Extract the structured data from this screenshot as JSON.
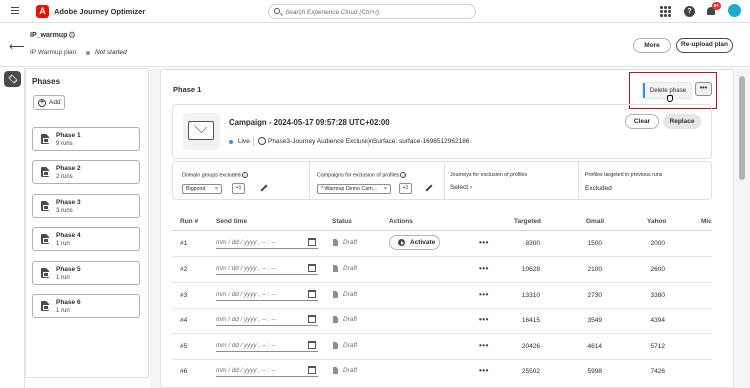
{
  "topbar": {
    "logo_letter": "A",
    "app_title": "Adobe Journey Optimizer",
    "search_placeholder": "Search Experience Cloud (Ctrl+/)",
    "notification_count": "9+"
  },
  "header": {
    "plan_name": "IP_warmup",
    "plan_type": "IP Warmup plan",
    "status": "Not started",
    "more_label": "More",
    "reupload_label": "Re-upload plan"
  },
  "phases_panel": {
    "title": "Phases",
    "add_label": "Add",
    "items": [
      {
        "name": "Phase 1",
        "runs": "9 runs"
      },
      {
        "name": "Phase 2",
        "runs": "2 runs"
      },
      {
        "name": "Phase 3",
        "runs": "3 runs"
      },
      {
        "name": "Phase 4",
        "runs": "1 run"
      },
      {
        "name": "Phase 5",
        "runs": "1 run"
      },
      {
        "name": "Phase 6",
        "runs": "1 run"
      }
    ]
  },
  "phase": {
    "title": "Phase 1",
    "delete_label": "Delete phase",
    "more_glyph": "•••",
    "campaign": {
      "name": "Campaign - 2024-05-17 09:57:28 UTC+02:00",
      "state": "Live",
      "journey": "Phase3-Journey Audience Exclusion",
      "surface": "Surface: surface-1696512962186",
      "clear_label": "Clear",
      "replace_label": "Replace"
    },
    "exclusions": {
      "domain_label": "Domain groups excluded",
      "domain_tag": "Bigpond",
      "domain_more": "+1",
      "campaigns_label": "Campaigns for exclusion of profiles",
      "campaigns_tag": "* Warmup Demo Cam...",
      "campaigns_more": "+1",
      "journeys_label": "Journeys for exclusion of profiles",
      "journeys_select": "Select",
      "targeted_label": "Profiles targeted in previous runs",
      "targeted_value": "Excluded"
    }
  },
  "table": {
    "headers": {
      "run": "Run #",
      "send_time": "Send time",
      "status": "Status",
      "actions": "Actions",
      "targeted": "Targeted",
      "gmail": "Gmail",
      "yahoo": "Yahoo",
      "mic": "Mic"
    },
    "date_placeholder": "mm / dd / yyyy ,  -- : --",
    "activate_label": "Activate",
    "rows": [
      {
        "run": "#1",
        "status": "Draft",
        "targeted": "8300",
        "gmail": "1500",
        "yahoo": "2000"
      },
      {
        "run": "#2",
        "status": "Draft",
        "targeted": "10628",
        "gmail": "2100",
        "yahoo": "2600"
      },
      {
        "run": "#3",
        "status": "Draft",
        "targeted": "13310",
        "gmail": "2730",
        "yahoo": "3380"
      },
      {
        "run": "#4",
        "status": "Draft",
        "targeted": "16415",
        "gmail": "3549",
        "yahoo": "4394"
      },
      {
        "run": "#5",
        "status": "Draft",
        "targeted": "20426",
        "gmail": "4614",
        "yahoo": "5712"
      },
      {
        "run": "#6",
        "status": "Draft",
        "targeted": "25502",
        "gmail": "5998",
        "yahoo": "7426"
      }
    ]
  },
  "colors": {
    "accent": "#378ef0",
    "brand": "#eb1000",
    "highlight_border": "#b0182a"
  }
}
